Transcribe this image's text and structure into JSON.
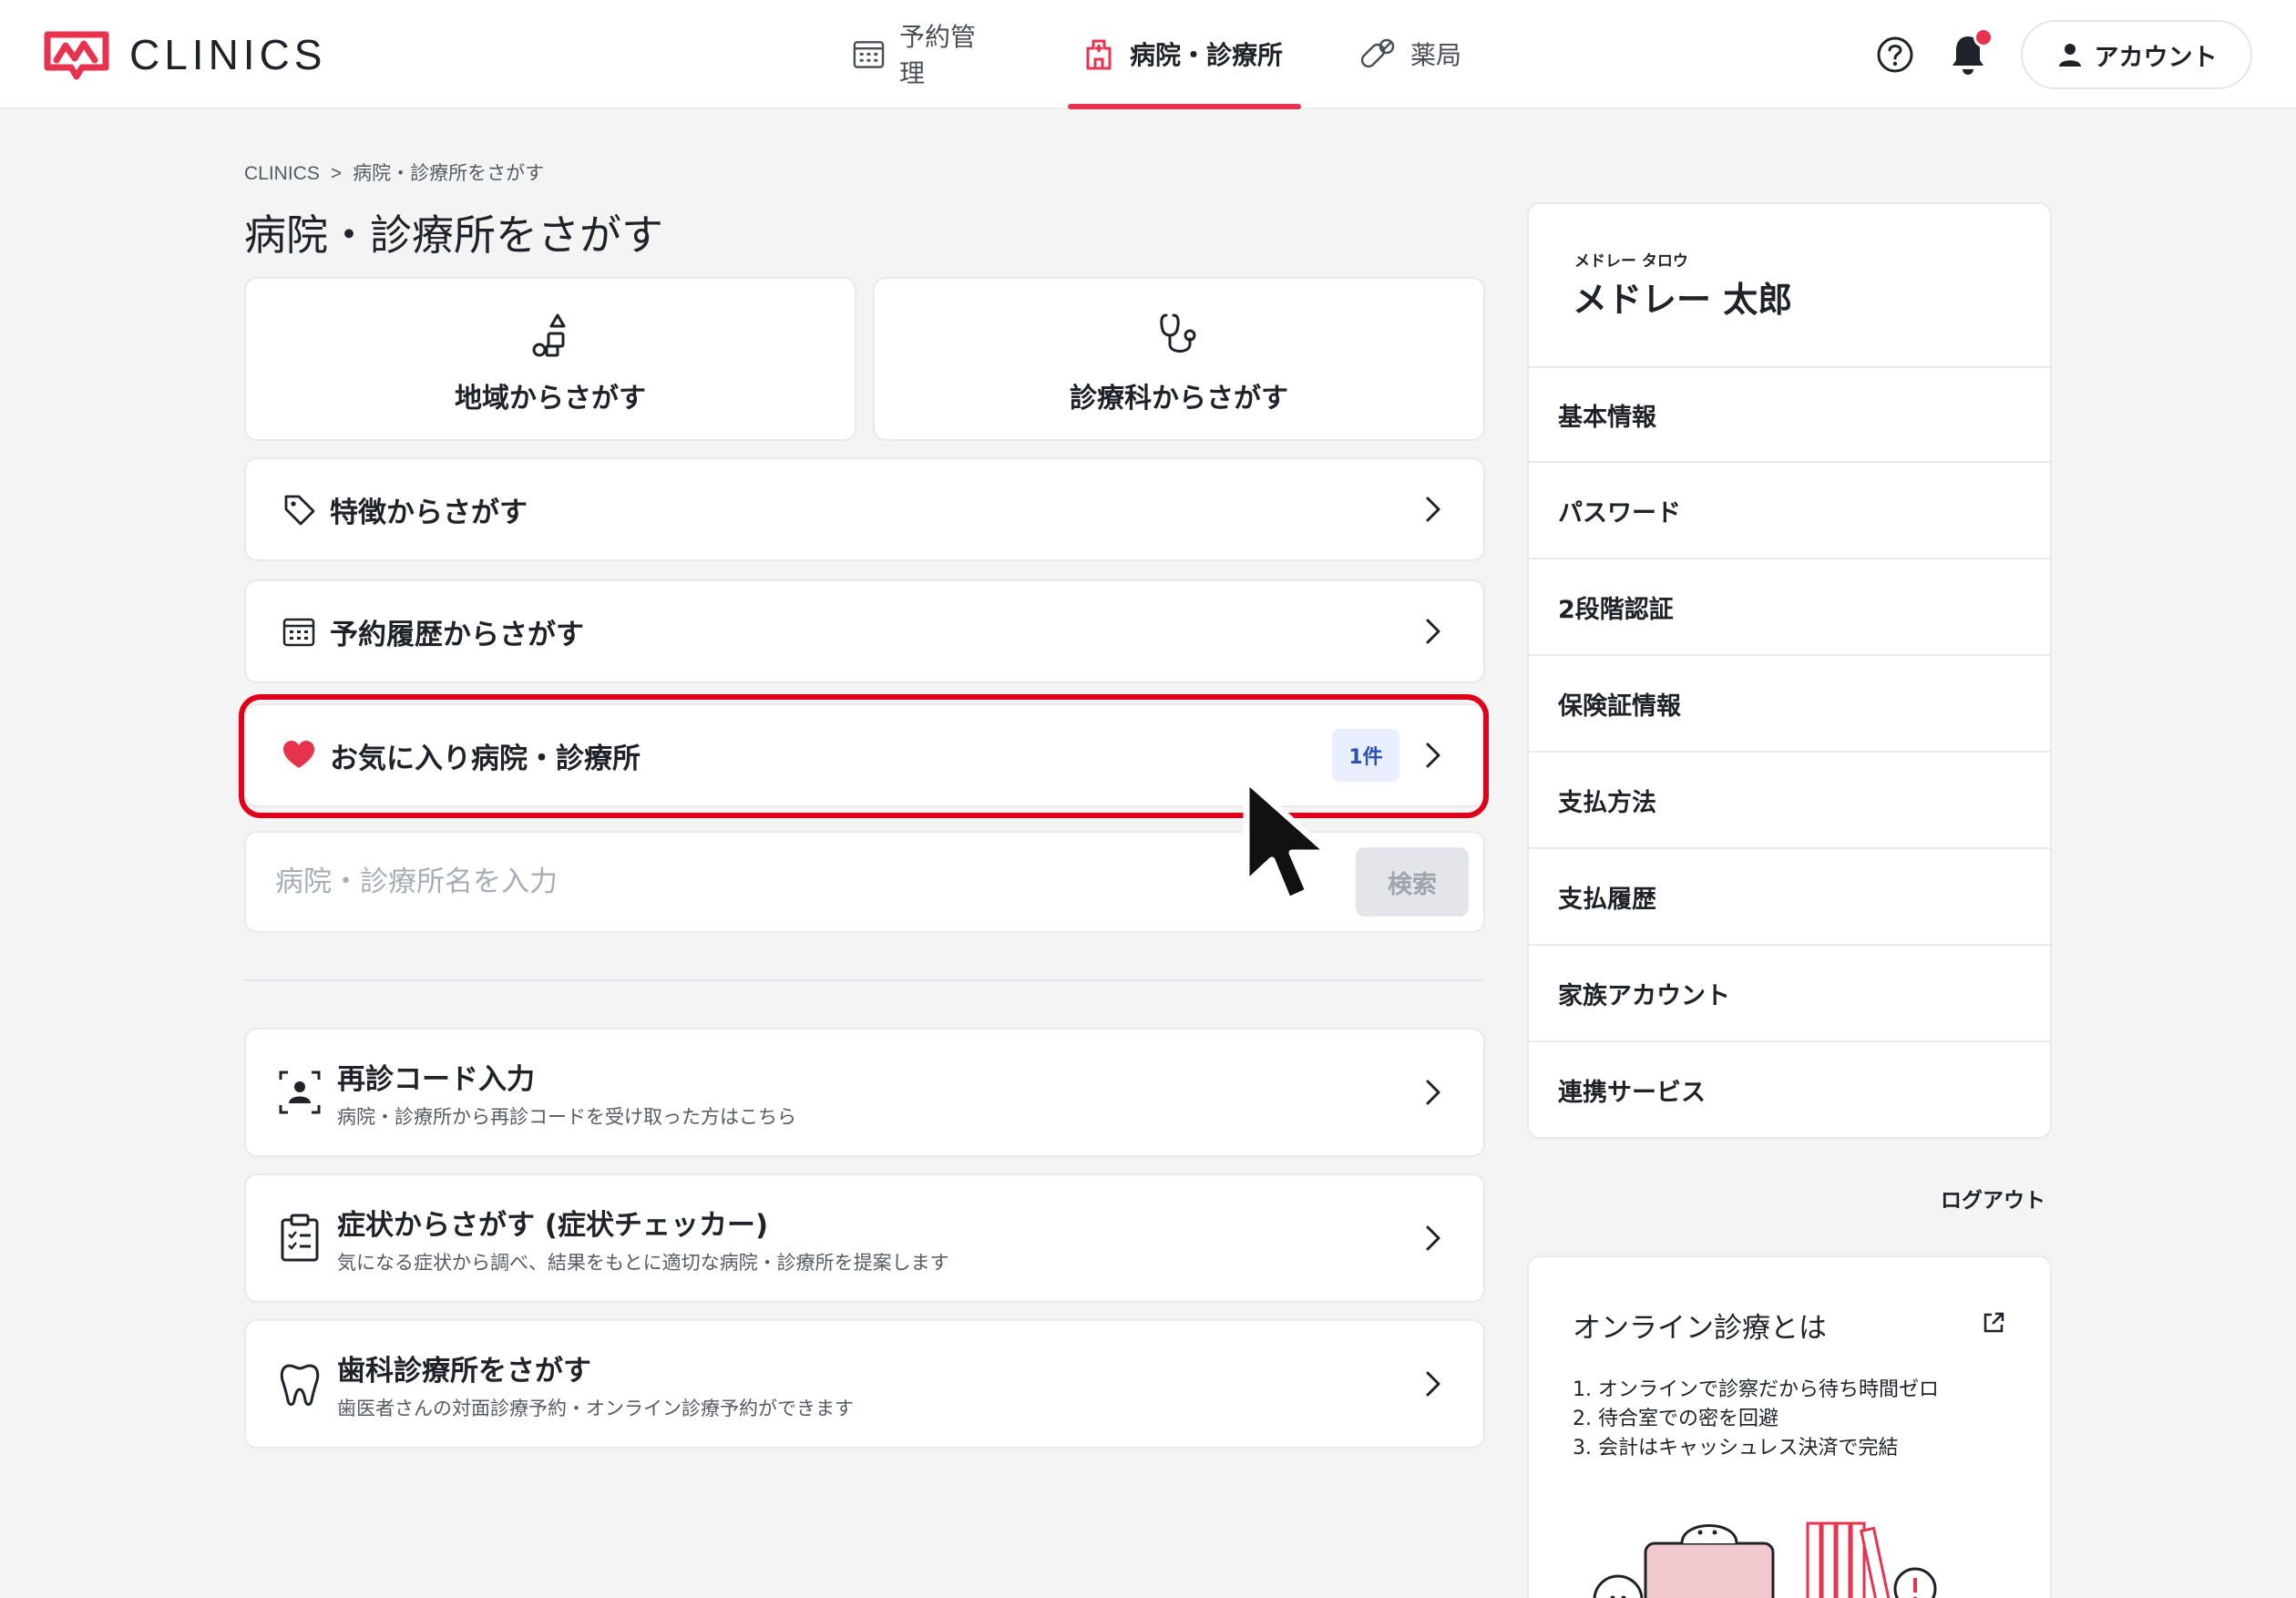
{
  "header": {
    "logo_text": "CLINICS",
    "nav": [
      {
        "label": "予約管理"
      },
      {
        "label": "病院・診療所"
      },
      {
        "label": "薬局"
      }
    ],
    "account_label": "アカウント"
  },
  "breadcrumb": {
    "root": "CLINICS",
    "separator": ">",
    "current": "病院・診療所をさがす"
  },
  "page_title": "病院・診療所をさがす",
  "tiles": {
    "area": "地域からさがす",
    "department": "診療科からさがす"
  },
  "rows": {
    "features": "特徴からさがす",
    "history": "予約履歴からさがす",
    "favorites": "お気に入り病院・診療所",
    "favorites_badge": "1件"
  },
  "search": {
    "placeholder": "病院・診療所名を入力",
    "button": "検索"
  },
  "rows2": [
    {
      "title": "再診コード入力",
      "subtitle": "病院・診療所から再診コードを受け取った方はこちら"
    },
    {
      "title": "症状からさがす (症状チェッカー)",
      "subtitle": "気になる症状から調べ、結果をもとに適切な病院・診療所を提案します"
    },
    {
      "title": "歯科診療所をさがす",
      "subtitle": "歯医者さんの対面診療予約・オンライン診療予約ができます"
    }
  ],
  "profile": {
    "kana": "メドレー タロウ",
    "name": "メドレー 太郎",
    "menu": [
      {
        "label": "基本情報"
      },
      {
        "label": "パスワード"
      },
      {
        "label": "2段階認証"
      },
      {
        "label": "保険証情報"
      },
      {
        "label": "支払方法"
      },
      {
        "label": "支払履歴"
      },
      {
        "label": "家族アカウント"
      },
      {
        "label": "連携サービス"
      }
    ],
    "logout": "ログアウト"
  },
  "online": {
    "title": "オンライン診療とは",
    "items": [
      "1. オンラインで診察だから待ち時間ゼロ",
      "2. 待合室での密を回避",
      "3. 会計はキャッシュレス決済で完結"
    ]
  },
  "colors": {
    "accent": "#e8334f",
    "highlight": "#e1001a",
    "badge_bg": "#e9efff",
    "badge_text": "#2b4fb3"
  },
  "icons": {
    "logo": "clinics-logo-icon",
    "nav": [
      "calendar-icon",
      "hospital-icon",
      "pills-icon"
    ],
    "help": "help-icon",
    "bell": "bell-icon",
    "account": "person-icon",
    "tiles": [
      "shapes-icon",
      "stethoscope-icon"
    ],
    "rows": [
      "tag-icon",
      "calendar-icon",
      "heart-icon",
      "chevron-right-icon"
    ],
    "rows2": [
      "face-scan-icon",
      "clipboard-icon",
      "tooth-icon"
    ],
    "external": "external-link-icon"
  }
}
